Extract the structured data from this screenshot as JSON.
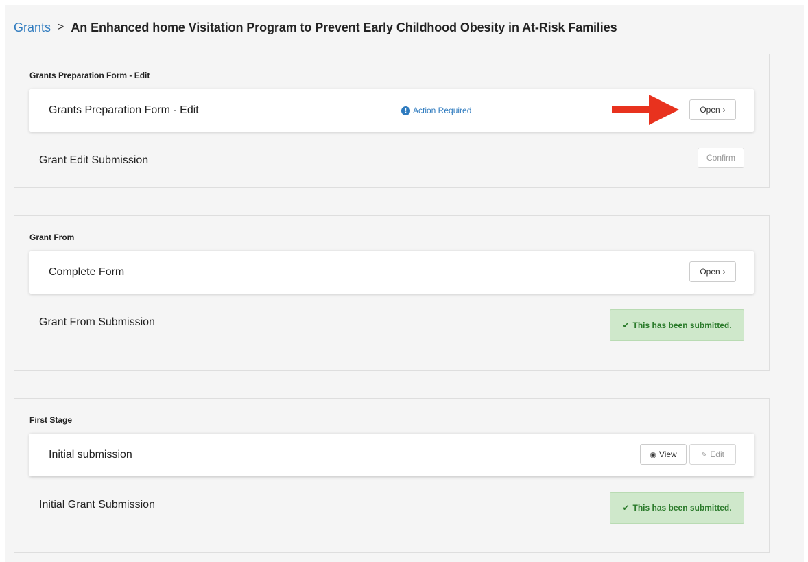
{
  "breadcrumb": {
    "root": "Grants",
    "separator": ">",
    "title": "An Enhanced home Visitation Program to Prevent Early Childhood Obesity in At-Risk Families"
  },
  "sections": [
    {
      "title": "Grants Preparation Form - Edit",
      "card": {
        "label": "Grants Preparation Form - Edit",
        "status": "Action Required",
        "status_icon": "info-icon",
        "open_label": "Open",
        "open_icon": "chevron-right-icon"
      },
      "row": {
        "label": "Grant Edit Submission",
        "confirm_label": "Confirm"
      }
    },
    {
      "title": "Grant From",
      "card": {
        "label": "Complete Form",
        "open_label": "Open",
        "open_icon": "chevron-right-icon"
      },
      "row": {
        "label": "Grant From Submission",
        "submitted_text": "This has been submitted.",
        "submitted_icon": "check-icon"
      }
    },
    {
      "title": "First Stage",
      "card": {
        "label": "Initial submission",
        "view_label": "View",
        "view_icon": "eye-icon",
        "edit_label": "Edit",
        "edit_icon": "edit-icon"
      },
      "row": {
        "label": "Initial Grant Submission",
        "submitted_text": "This has been submitted.",
        "submitted_icon": "check-icon"
      }
    }
  ],
  "colors": {
    "link": "#2f7bbf",
    "annotation_arrow": "#e8321e",
    "submitted_bg": "#cfe8cb",
    "submitted_text": "#2a7a2a"
  }
}
